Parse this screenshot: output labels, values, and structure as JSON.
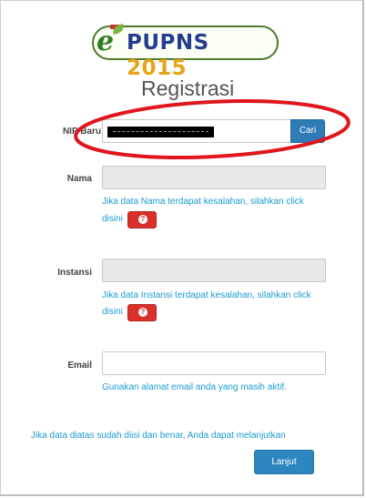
{
  "logo": {
    "text_main": "PUPNS",
    "text_year": "2015"
  },
  "page_title": "Registrasi",
  "nip": {
    "label": "NIP Baru",
    "button": "Cari"
  },
  "nama": {
    "label": "Nama",
    "help_line1": "Jika data Nama terdapat kesalahan, silahkan click",
    "help_line2": "disini"
  },
  "instansi": {
    "label": "Instansi",
    "help_line1": "Jika data Instansi terdapat kesalahan, silahkan click",
    "help_line2": "disini"
  },
  "email": {
    "label": "Email",
    "help": "Gunakan alamat email anda yang masih aktif."
  },
  "footer": {
    "note": "Jika data diatas sudah diisi dan benar, Anda dapat melanjutkan",
    "button": "Lanjut"
  },
  "icons": {
    "help_button": "question-circle-icon"
  },
  "colors": {
    "annotation": "#e0161c",
    "primary_button": "#2f7bb6",
    "help_button": "#d9302c",
    "link_text": "#1a9bd0"
  }
}
